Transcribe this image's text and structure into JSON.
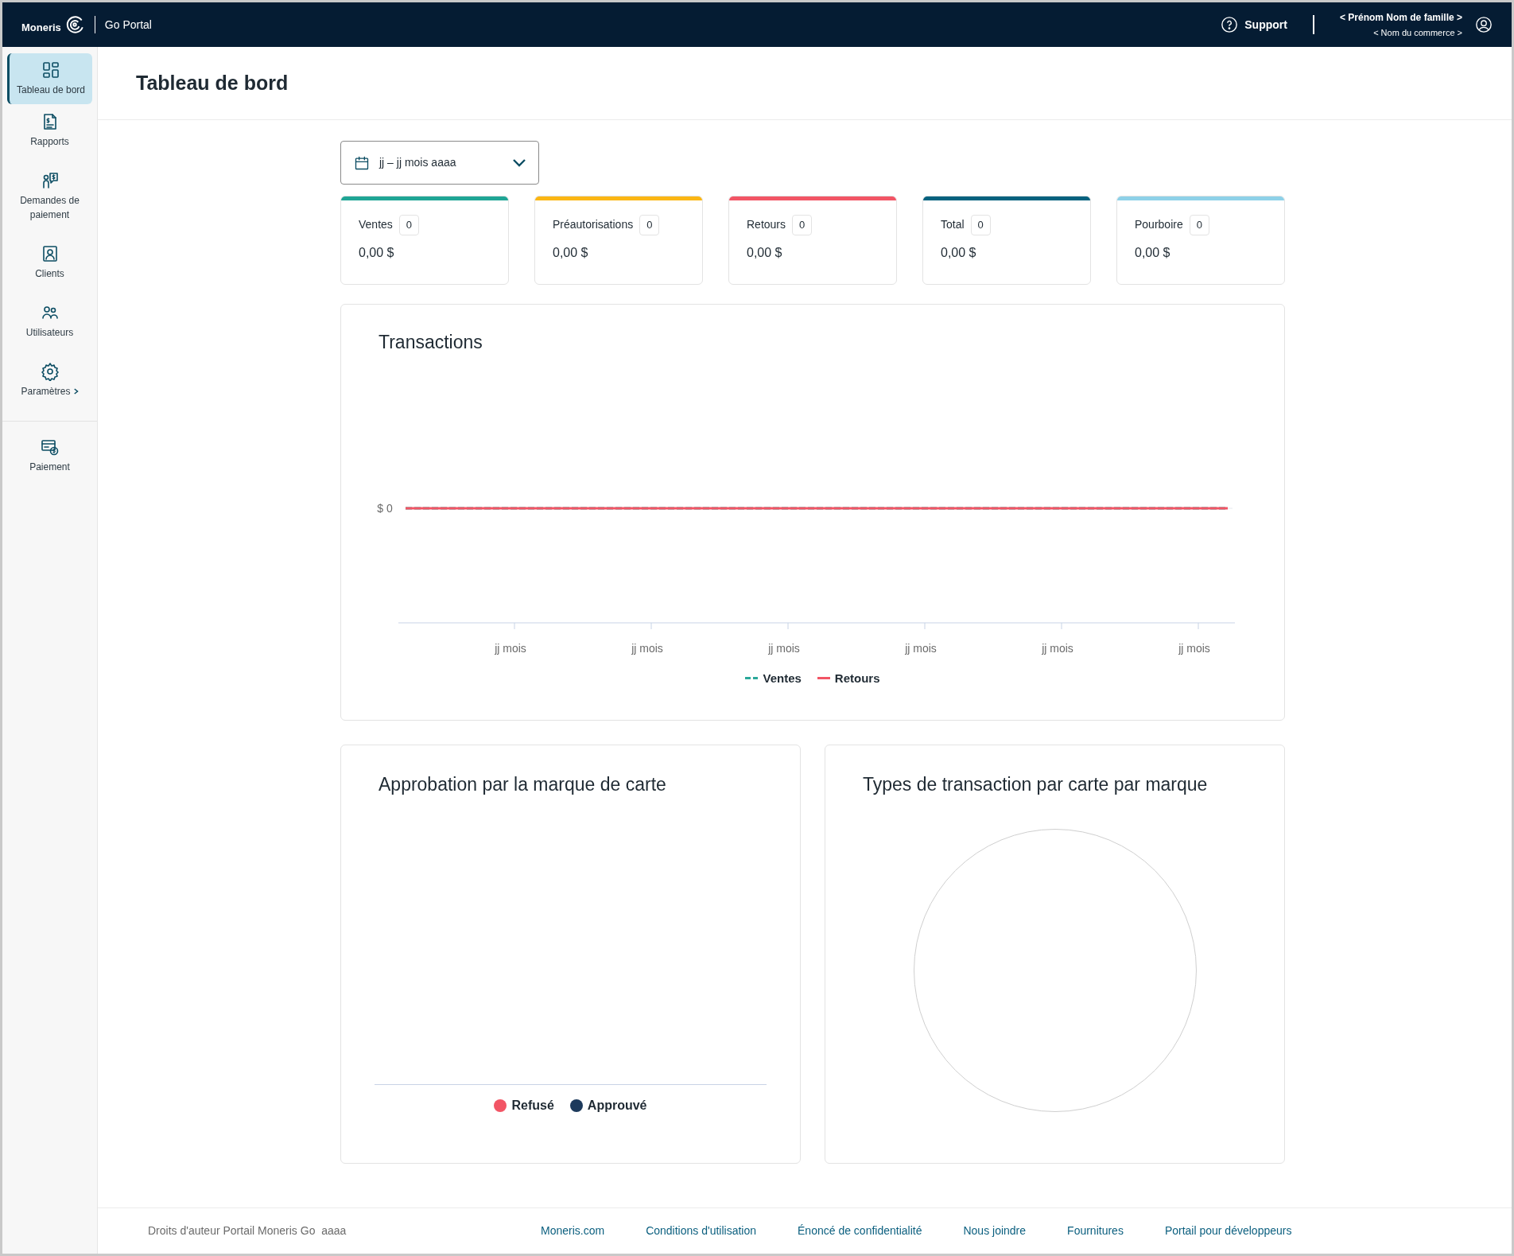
{
  "header": {
    "logo": "Moneris",
    "product": "Go Portal",
    "support": "Support",
    "user_name": "< Prénom Nom de famille >",
    "merchant_name": "< Nom du commerce >"
  },
  "sidebar": {
    "items": [
      {
        "label": "Tableau de bord",
        "selected": true,
        "has_submenu": false
      },
      {
        "label": "Rapports",
        "selected": false,
        "has_submenu": false
      },
      {
        "label": "Demandes de paiement",
        "selected": false,
        "has_submenu": false
      },
      {
        "label": "Clients",
        "selected": false,
        "has_submenu": false
      },
      {
        "label": "Utilisateurs",
        "selected": false,
        "has_submenu": false
      },
      {
        "label": "Paramètres",
        "selected": false,
        "has_submenu": true
      }
    ],
    "bottom_items": [
      {
        "label": "Paiement",
        "selected": false
      }
    ]
  },
  "page_title": "Tableau de bord",
  "date_range": {
    "value": "jj – jj mois aaaa"
  },
  "summary_cards": [
    {
      "label": "Ventes",
      "count": "0",
      "amount": "0,00 $",
      "color": "#1fa595"
    },
    {
      "label": "Préautorisations",
      "count": "0",
      "amount": "0,00 $",
      "color": "#fbb614"
    },
    {
      "label": "Retours",
      "count": "0",
      "amount": "0,00 $",
      "color": "#f25565"
    },
    {
      "label": "Total",
      "count": "0",
      "amount": "0,00 $",
      "color": "#05627f"
    },
    {
      "label": "Pourboire",
      "count": "0",
      "amount": "0,00 $",
      "color": "#8ed1e8"
    }
  ],
  "transactions": {
    "title": "Transactions",
    "y_label": "$ 0",
    "x_labels": [
      "jj mois",
      "jj mois",
      "jj mois",
      "jj mois",
      "jj mois",
      "jj mois"
    ],
    "legend": [
      {
        "label": "Ventes",
        "color": "#2aa89a",
        "kind": "dashed"
      },
      {
        "label": "Retours",
        "color": "#f25565",
        "kind": "solid"
      }
    ]
  },
  "approval": {
    "title": "Approbation par la marque de carte",
    "legend": [
      {
        "label": "Refusé",
        "color": "#f25565"
      },
      {
        "label": "Approuvé",
        "color": "#1d3a5c"
      }
    ]
  },
  "card_types": {
    "title": "Types de transaction par carte par marque"
  },
  "footer": {
    "copyright": "Droits d'auteur Portail Moneris Go  aaaa",
    "links": [
      "Moneris.com",
      "Conditions d'utilisation",
      "Énoncé de confidentialité",
      "Nous joindre",
      "Fournitures",
      "Portail pour développeurs"
    ]
  }
}
